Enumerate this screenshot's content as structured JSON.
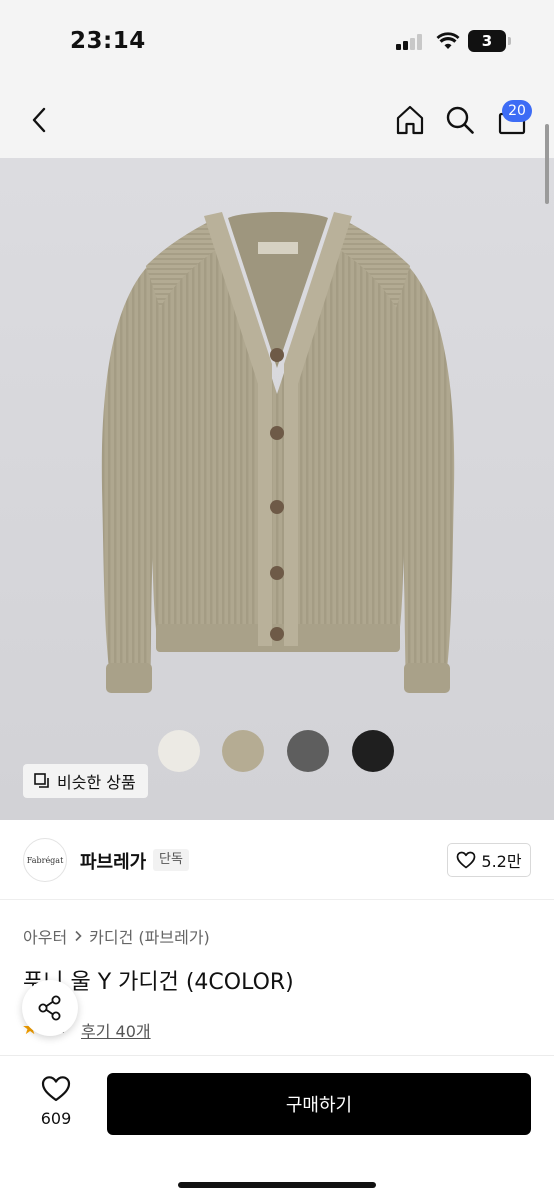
{
  "status": {
    "time": "23:14",
    "battery": "3"
  },
  "header": {
    "cart_count": "20"
  },
  "swatches": [
    {
      "name": "white",
      "color": "#eceae4"
    },
    {
      "name": "beige",
      "color": "#b5ac93"
    },
    {
      "name": "gray",
      "color": "#5e5e5e"
    },
    {
      "name": "black",
      "color": "#1f1f1f"
    }
  ],
  "similar": {
    "label": "비슷한 상품"
  },
  "brand": {
    "logo_text": "Fabrégat",
    "name": "파브레가",
    "tag": "단독",
    "likes": "5.2만"
  },
  "breadcrumb": {
    "category": "아우터",
    "subcategory": "카디건 (파브레가)"
  },
  "product": {
    "title": "푸니 울 Y 가디건 (4COLOR)",
    "rating": ".7",
    "reviews": "후기 40개"
  },
  "bottom": {
    "wish_count": "609",
    "buy_label": "구매하기"
  },
  "colors": {
    "accent": "#3d6cf5",
    "star": "#f5a000",
    "buy_button": "#000000"
  }
}
